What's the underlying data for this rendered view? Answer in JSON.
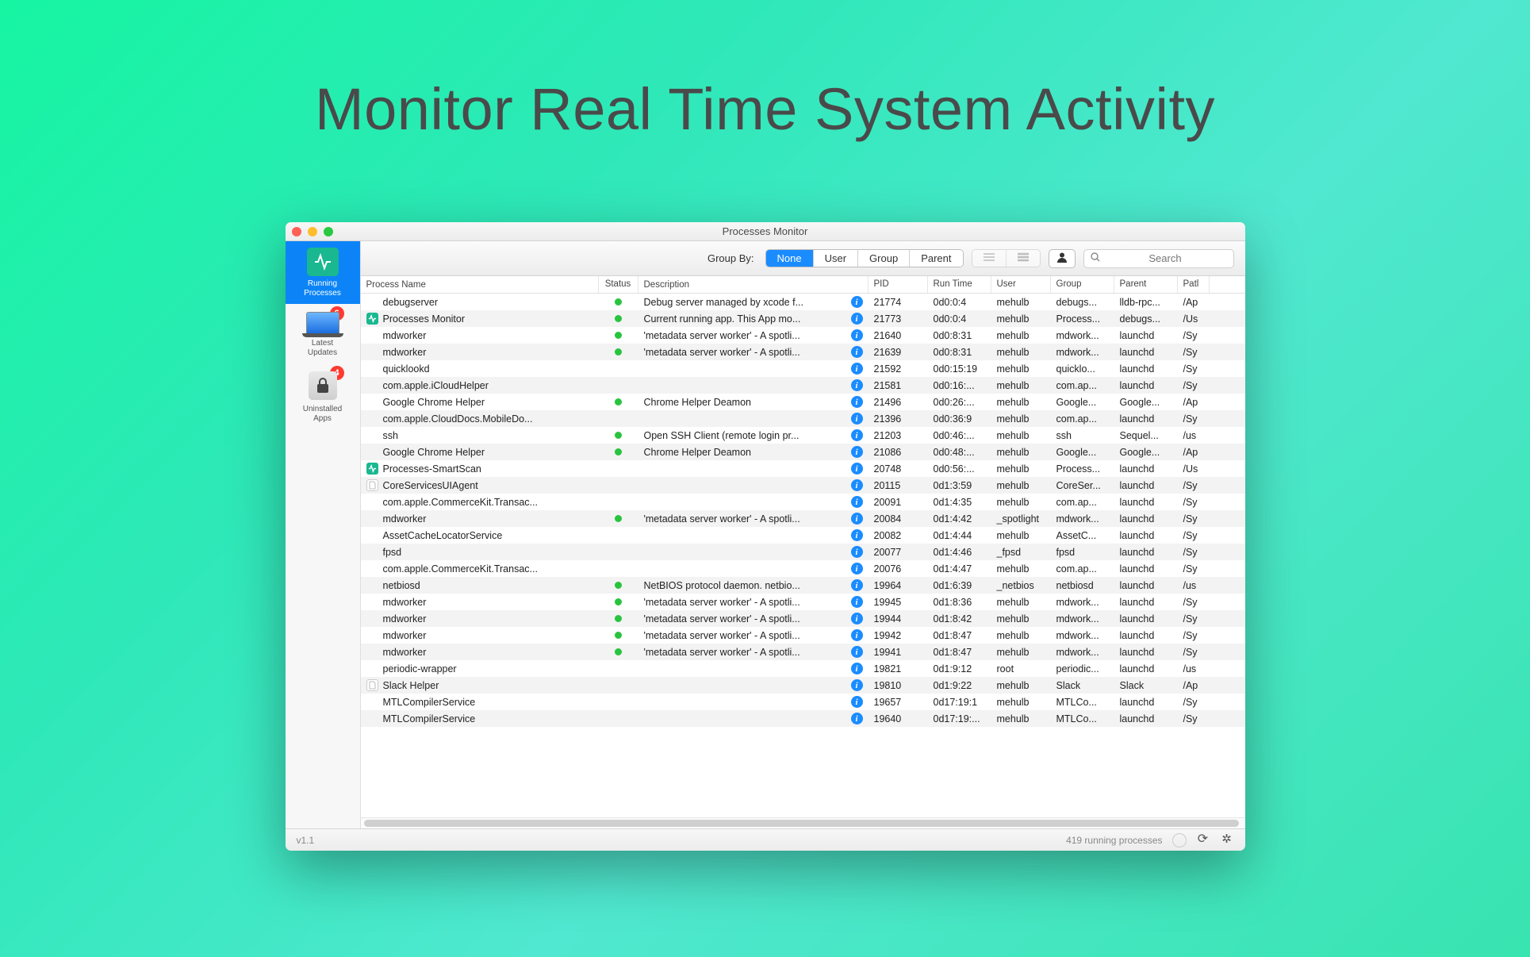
{
  "hero": {
    "title": "Monitor Real Time System Activity"
  },
  "window": {
    "title": "Processes Monitor"
  },
  "sidebar": {
    "items": [
      {
        "label": "Running\nProcesses",
        "active": true,
        "icon": "pulse",
        "badge": null
      },
      {
        "label": "Latest\nUpdates",
        "active": false,
        "icon": "laptop",
        "badge": "6"
      },
      {
        "label": "Uninstalled\nApps",
        "active": false,
        "icon": "trash-lock",
        "badge": "4"
      }
    ]
  },
  "toolbar": {
    "groupby_label": "Group By:",
    "groupby_options": [
      "None",
      "User",
      "Group",
      "Parent"
    ],
    "groupby_selected": "None",
    "search_placeholder": "Search"
  },
  "columns": [
    "Process Name",
    "Status",
    "Description",
    "PID",
    "Run Time",
    "User",
    "Group",
    "Parent",
    "Patl"
  ],
  "statusbar": {
    "version": "v1.1",
    "count_text": "419 running processes"
  },
  "rows": [
    {
      "icon": "",
      "name": "debugserver",
      "status": true,
      "desc": "Debug server managed by xcode f...",
      "info": true,
      "pid": "21774",
      "run": "0d0:0:4",
      "user": "mehulb",
      "group": "debugs...",
      "parent": "lldb-rpc...",
      "path": "/Ap"
    },
    {
      "icon": "pulse-teal",
      "name": "Processes Monitor",
      "status": true,
      "desc": "Current running app. This App mo...",
      "info": true,
      "pid": "21773",
      "run": "0d0:0:4",
      "user": "mehulb",
      "group": "Process...",
      "parent": "debugs...",
      "path": "/Us"
    },
    {
      "icon": "",
      "name": "mdworker",
      "status": true,
      "desc": "'metadata server worker' - A spotli...",
      "info": true,
      "pid": "21640",
      "run": "0d0:8:31",
      "user": "mehulb",
      "group": "mdwork...",
      "parent": "launchd",
      "path": "/Sy"
    },
    {
      "icon": "",
      "name": "mdworker",
      "status": true,
      "desc": "'metadata server worker' - A spotli...",
      "info": true,
      "pid": "21639",
      "run": "0d0:8:31",
      "user": "mehulb",
      "group": "mdwork...",
      "parent": "launchd",
      "path": "/Sy"
    },
    {
      "icon": "",
      "name": "quicklookd",
      "status": false,
      "desc": "",
      "info": true,
      "pid": "21592",
      "run": "0d0:15:19",
      "user": "mehulb",
      "group": "quicklo...",
      "parent": "launchd",
      "path": "/Sy"
    },
    {
      "icon": "",
      "name": "com.apple.iCloudHelper",
      "status": false,
      "desc": "",
      "info": true,
      "pid": "21581",
      "run": "0d0:16:...",
      "user": "mehulb",
      "group": "com.ap...",
      "parent": "launchd",
      "path": "/Sy"
    },
    {
      "icon": "",
      "name": "Google Chrome Helper",
      "status": true,
      "desc": "Chrome Helper Deamon",
      "info": true,
      "pid": "21496",
      "run": "0d0:26:...",
      "user": "mehulb",
      "group": "Google...",
      "parent": "Google...",
      "path": "/Ap"
    },
    {
      "icon": "",
      "name": "com.apple.CloudDocs.MobileDo...",
      "status": false,
      "desc": "",
      "info": true,
      "pid": "21396",
      "run": "0d0:36:9",
      "user": "mehulb",
      "group": "com.ap...",
      "parent": "launchd",
      "path": "/Sy"
    },
    {
      "icon": "",
      "name": "ssh",
      "status": true,
      "desc": "Open SSH Client (remote login pr...",
      "info": true,
      "pid": "21203",
      "run": "0d0:46:...",
      "user": "mehulb",
      "group": "ssh",
      "parent": "Sequel...",
      "path": "/us"
    },
    {
      "icon": "",
      "name": "Google Chrome Helper",
      "status": true,
      "desc": "Chrome Helper Deamon",
      "info": true,
      "pid": "21086",
      "run": "0d0:48:...",
      "user": "mehulb",
      "group": "Google...",
      "parent": "Google...",
      "path": "/Ap"
    },
    {
      "icon": "pulse-teal",
      "name": "Processes-SmartScan",
      "status": false,
      "desc": "",
      "info": true,
      "pid": "20748",
      "run": "0d0:56:...",
      "user": "mehulb",
      "group": "Process...",
      "parent": "launchd",
      "path": "/Us"
    },
    {
      "icon": "doc",
      "name": "CoreServicesUIAgent",
      "status": false,
      "desc": "",
      "info": true,
      "pid": "20115",
      "run": "0d1:3:59",
      "user": "mehulb",
      "group": "CoreSer...",
      "parent": "launchd",
      "path": "/Sy"
    },
    {
      "icon": "",
      "name": "com.apple.CommerceKit.Transac...",
      "status": false,
      "desc": "",
      "info": true,
      "pid": "20091",
      "run": "0d1:4:35",
      "user": "mehulb",
      "group": "com.ap...",
      "parent": "launchd",
      "path": "/Sy"
    },
    {
      "icon": "",
      "name": "mdworker",
      "status": true,
      "desc": "'metadata server worker' - A spotli...",
      "info": true,
      "pid": "20084",
      "run": "0d1:4:42",
      "user": "_spotlight",
      "group": "mdwork...",
      "parent": "launchd",
      "path": "/Sy"
    },
    {
      "icon": "",
      "name": "AssetCacheLocatorService",
      "status": false,
      "desc": "",
      "info": true,
      "pid": "20082",
      "run": "0d1:4:44",
      "user": "mehulb",
      "group": "AssetC...",
      "parent": "launchd",
      "path": "/Sy"
    },
    {
      "icon": "",
      "name": "fpsd",
      "status": false,
      "desc": "",
      "info": true,
      "pid": "20077",
      "run": "0d1:4:46",
      "user": "_fpsd",
      "group": "fpsd",
      "parent": "launchd",
      "path": "/Sy"
    },
    {
      "icon": "",
      "name": "com.apple.CommerceKit.Transac...",
      "status": false,
      "desc": "",
      "info": true,
      "pid": "20076",
      "run": "0d1:4:47",
      "user": "mehulb",
      "group": "com.ap...",
      "parent": "launchd",
      "path": "/Sy"
    },
    {
      "icon": "",
      "name": "netbiosd",
      "status": true,
      "desc": "NetBIOS protocol daemon. netbio...",
      "info": true,
      "pid": "19964",
      "run": "0d1:6:39",
      "user": "_netbios",
      "group": "netbiosd",
      "parent": "launchd",
      "path": "/us"
    },
    {
      "icon": "",
      "name": "mdworker",
      "status": true,
      "desc": "'metadata server worker' - A spotli...",
      "info": true,
      "pid": "19945",
      "run": "0d1:8:36",
      "user": "mehulb",
      "group": "mdwork...",
      "parent": "launchd",
      "path": "/Sy"
    },
    {
      "icon": "",
      "name": "mdworker",
      "status": true,
      "desc": "'metadata server worker' - A spotli...",
      "info": true,
      "pid": "19944",
      "run": "0d1:8:42",
      "user": "mehulb",
      "group": "mdwork...",
      "parent": "launchd",
      "path": "/Sy"
    },
    {
      "icon": "",
      "name": "mdworker",
      "status": true,
      "desc": "'metadata server worker' - A spotli...",
      "info": true,
      "pid": "19942",
      "run": "0d1:8:47",
      "user": "mehulb",
      "group": "mdwork...",
      "parent": "launchd",
      "path": "/Sy"
    },
    {
      "icon": "",
      "name": "mdworker",
      "status": true,
      "desc": "'metadata server worker' - A spotli...",
      "info": true,
      "pid": "19941",
      "run": "0d1:8:47",
      "user": "mehulb",
      "group": "mdwork...",
      "parent": "launchd",
      "path": "/Sy"
    },
    {
      "icon": "",
      "name": "periodic-wrapper",
      "status": false,
      "desc": "",
      "info": true,
      "pid": "19821",
      "run": "0d1:9:12",
      "user": "root",
      "group": "periodic...",
      "parent": "launchd",
      "path": "/us"
    },
    {
      "icon": "doc",
      "name": "Slack Helper",
      "status": false,
      "desc": "",
      "info": true,
      "pid": "19810",
      "run": "0d1:9:22",
      "user": "mehulb",
      "group": "Slack",
      "parent": "Slack",
      "path": "/Ap"
    },
    {
      "icon": "",
      "name": "MTLCompilerService",
      "status": false,
      "desc": "",
      "info": true,
      "pid": "19657",
      "run": "0d17:19:1",
      "user": "mehulb",
      "group": "MTLCo...",
      "parent": "launchd",
      "path": "/Sy"
    },
    {
      "icon": "",
      "name": "MTLCompilerService",
      "status": false,
      "desc": "",
      "info": true,
      "pid": "19640",
      "run": "0d17:19:...",
      "user": "mehulb",
      "group": "MTLCo...",
      "parent": "launchd",
      "path": "/Sy"
    }
  ]
}
